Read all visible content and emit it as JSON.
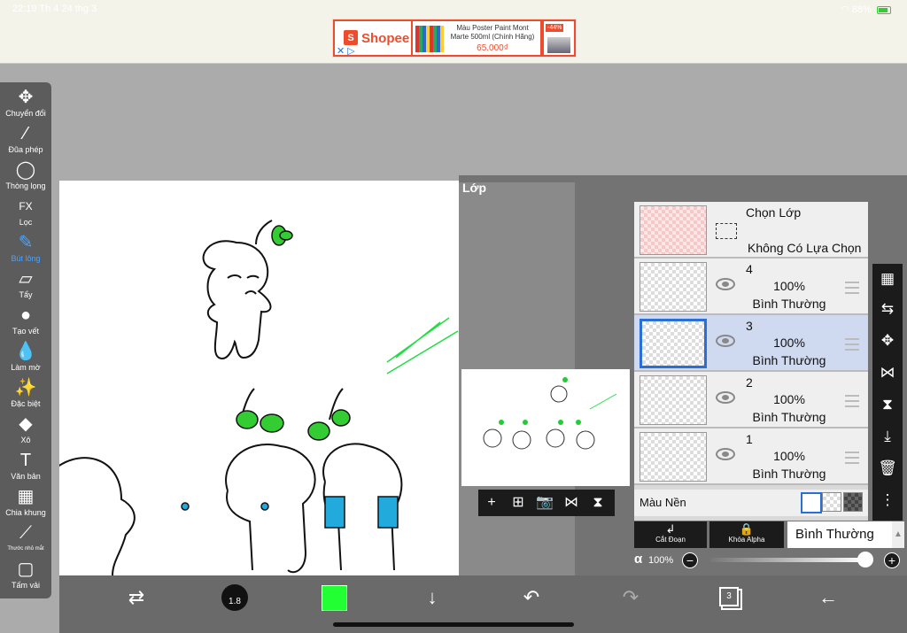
{
  "status": {
    "time_date": "22:19   Th 4 24 thg 3",
    "battery": "88%"
  },
  "ad": {
    "brand": "Shopee",
    "brand_mark": "S",
    "close_glyph": "✕ ▷",
    "product_name": "Màu Poster Paint Mont Marte 500ml (Chính Hãng)",
    "product_price": "65.000₫",
    "discount": "-44%",
    "brand_color": "#ee4d2d"
  },
  "toolbar": {
    "items": [
      {
        "label": "Chuyển đổi",
        "icon": "move-icon",
        "glyph": "✥"
      },
      {
        "label": "Đũa phép",
        "icon": "magic-wand-icon",
        "glyph": "⁄"
      },
      {
        "label": "Thòng lọng",
        "icon": "lasso-icon",
        "glyph": "◯"
      },
      {
        "label": "Lọc",
        "icon": "fx-filter-icon",
        "glyph": "FX"
      },
      {
        "label": "Bút lông",
        "icon": "brush-icon",
        "glyph": "✎",
        "active": true
      },
      {
        "label": "Tẩy",
        "icon": "eraser-icon",
        "glyph": "▱"
      },
      {
        "label": "Tạo vết",
        "icon": "smudge-icon",
        "glyph": "●"
      },
      {
        "label": "Làm mờ",
        "icon": "blur-drop-icon",
        "glyph": "💧"
      },
      {
        "label": "Đặc biệt",
        "icon": "special-brush-icon",
        "glyph": "✨"
      },
      {
        "label": "Xô",
        "icon": "fill-bucket-icon",
        "glyph": "◆"
      },
      {
        "label": "Văn bản",
        "icon": "text-icon",
        "glyph": "T"
      },
      {
        "label": "Chia khung",
        "icon": "frame-divider-icon",
        "glyph": "▦"
      },
      {
        "label": "Thước nhỏ mắt",
        "icon": "eyedropper-icon",
        "glyph": "⟋"
      },
      {
        "label": "Tấm vải",
        "icon": "canvas-icon",
        "glyph": "▢"
      }
    ]
  },
  "bottom_bar": {
    "brush_size": "1.8",
    "color": "#22ff33",
    "layer_count": "3",
    "icons": {
      "transform": "⇄",
      "down": "↓",
      "undo": "↶",
      "redo": "↷",
      "back": "←"
    }
  },
  "layer_panel": {
    "title": "Lớp",
    "selection": {
      "title": "Chọn Lớp",
      "status": "Không Có Lựa Chọn"
    },
    "layers": [
      {
        "name": "4",
        "opacity": "100%",
        "mode": "Bình Thường",
        "selected": false
      },
      {
        "name": "3",
        "opacity": "100%",
        "mode": "Bình Thường",
        "selected": true
      },
      {
        "name": "2",
        "opacity": "100%",
        "mode": "Bình Thường",
        "selected": false
      },
      {
        "name": "1",
        "opacity": "100%",
        "mode": "Bình Thường",
        "selected": false
      }
    ],
    "background_label": "Màu Nền",
    "clip_label": "Cắt Đoạn",
    "alpha_lock_label": "Khóa Alpha",
    "blend_mode": "Bình Thường",
    "alpha_symbol": "α",
    "alpha_value": "100%",
    "minus": "−",
    "plus": "+",
    "preview_buttons": [
      "+",
      "⊞",
      "📷",
      "⋈",
      "⧗"
    ],
    "side_tools": [
      "▦",
      "⇆",
      "✥",
      "⋈",
      "⧗",
      "⤓",
      "🗑",
      "⋮"
    ],
    "clip_glyph": "↲",
    "alpha_glyph": "🔒"
  }
}
